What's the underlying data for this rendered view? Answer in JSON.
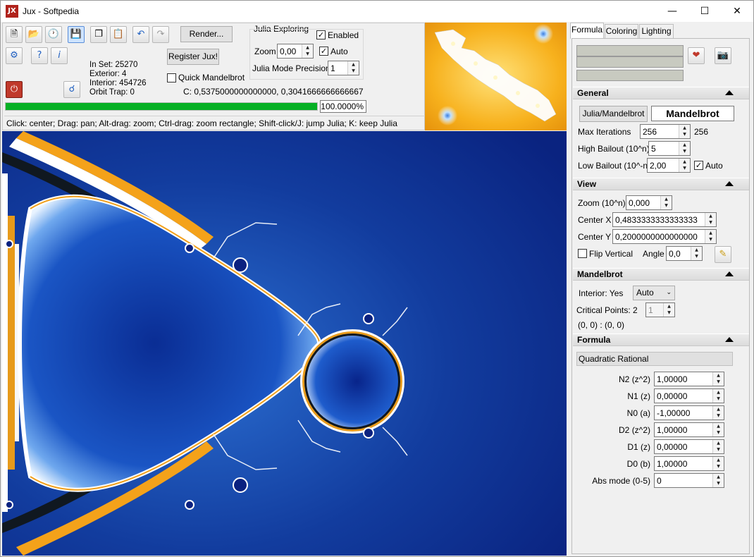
{
  "window": {
    "title": "Jux - Softpedia",
    "app_icon_text": "JX"
  },
  "toolbar": {
    "render_label": "Render...",
    "register_label": "Register Jux!",
    "quick_mandelbrot_label": "Quick Mandelbrot",
    "quick_mandelbrot_checked": false,
    "stats": {
      "in_set": "In Set: 25270",
      "exterior": "Exterior: 4",
      "interior": "Interior: 454726",
      "orbit_trap": "Orbit Trap: 0"
    },
    "c_value": "C:  0,5375000000000000, 0,3041666666666667",
    "progress_percent": 100,
    "progress_text": "100.0000%"
  },
  "julia": {
    "group_title": "Julia Exploring",
    "enabled_label": "Enabled",
    "enabled_checked": true,
    "zoom_label": "Zoom",
    "zoom_value": "0,00",
    "auto_label": "Auto",
    "auto_checked": true,
    "precision_label": "Julia Mode Precision",
    "precision_value": "1"
  },
  "status": "Click: center; Drag: pan; Alt-drag: zoom; Ctrl-drag: zoom rectangle; Shift-click/J: jump Julia; K: keep Julia",
  "tabs": [
    {
      "label": "Formula",
      "active": true
    },
    {
      "label": "Coloring",
      "active": false
    },
    {
      "label": "Lighting",
      "active": false
    }
  ],
  "general": {
    "header": "General",
    "julia_mandelbrot_label": "Julia/Mandelbrot",
    "mode_value": "Mandelbrot",
    "max_iterations_label": "Max Iterations",
    "max_iterations_value": "256",
    "max_iterations_extra": "256",
    "high_bailout_label": "High Bailout (10^n)",
    "high_bailout_value": "5",
    "low_bailout_label": "Low Bailout (10^-n)",
    "low_bailout_value": "2,00",
    "low_bailout_auto_label": "Auto",
    "low_bailout_auto_checked": true
  },
  "view": {
    "header": "View",
    "zoom_label": "Zoom (10^n)",
    "zoom_value": "0,000",
    "center_x_label": "Center X",
    "center_x_value": "0,4833333333333333",
    "center_y_label": "Center Y",
    "center_y_value": "0,2000000000000000",
    "flip_vertical_label": "Flip Vertical",
    "flip_vertical_checked": false,
    "angle_label": "Angle",
    "angle_value": "0,0"
  },
  "mandelbrot": {
    "header": "Mandelbrot",
    "interior_label": "Interior: Yes",
    "interior_value": "Auto",
    "critical_points_label": "Critical Points:  2",
    "critical_points_value": "1",
    "critical_point_coords": "(0, 0) : (0, 0)"
  },
  "formula": {
    "header": "Formula",
    "name": "Quadratic Rational",
    "params": [
      {
        "label": "N2 (z^2)",
        "value": "1,00000"
      },
      {
        "label": "N1 (z)",
        "value": "0,00000"
      },
      {
        "label": "N0 (a)",
        "value": "-1,00000"
      },
      {
        "label": "D2 (z^2)",
        "value": "1,00000"
      },
      {
        "label": "D1 (z)",
        "value": "0,00000"
      },
      {
        "label": "D0 (b)",
        "value": "1,00000"
      },
      {
        "label": "Abs mode (0-5)",
        "value": "0"
      }
    ]
  }
}
